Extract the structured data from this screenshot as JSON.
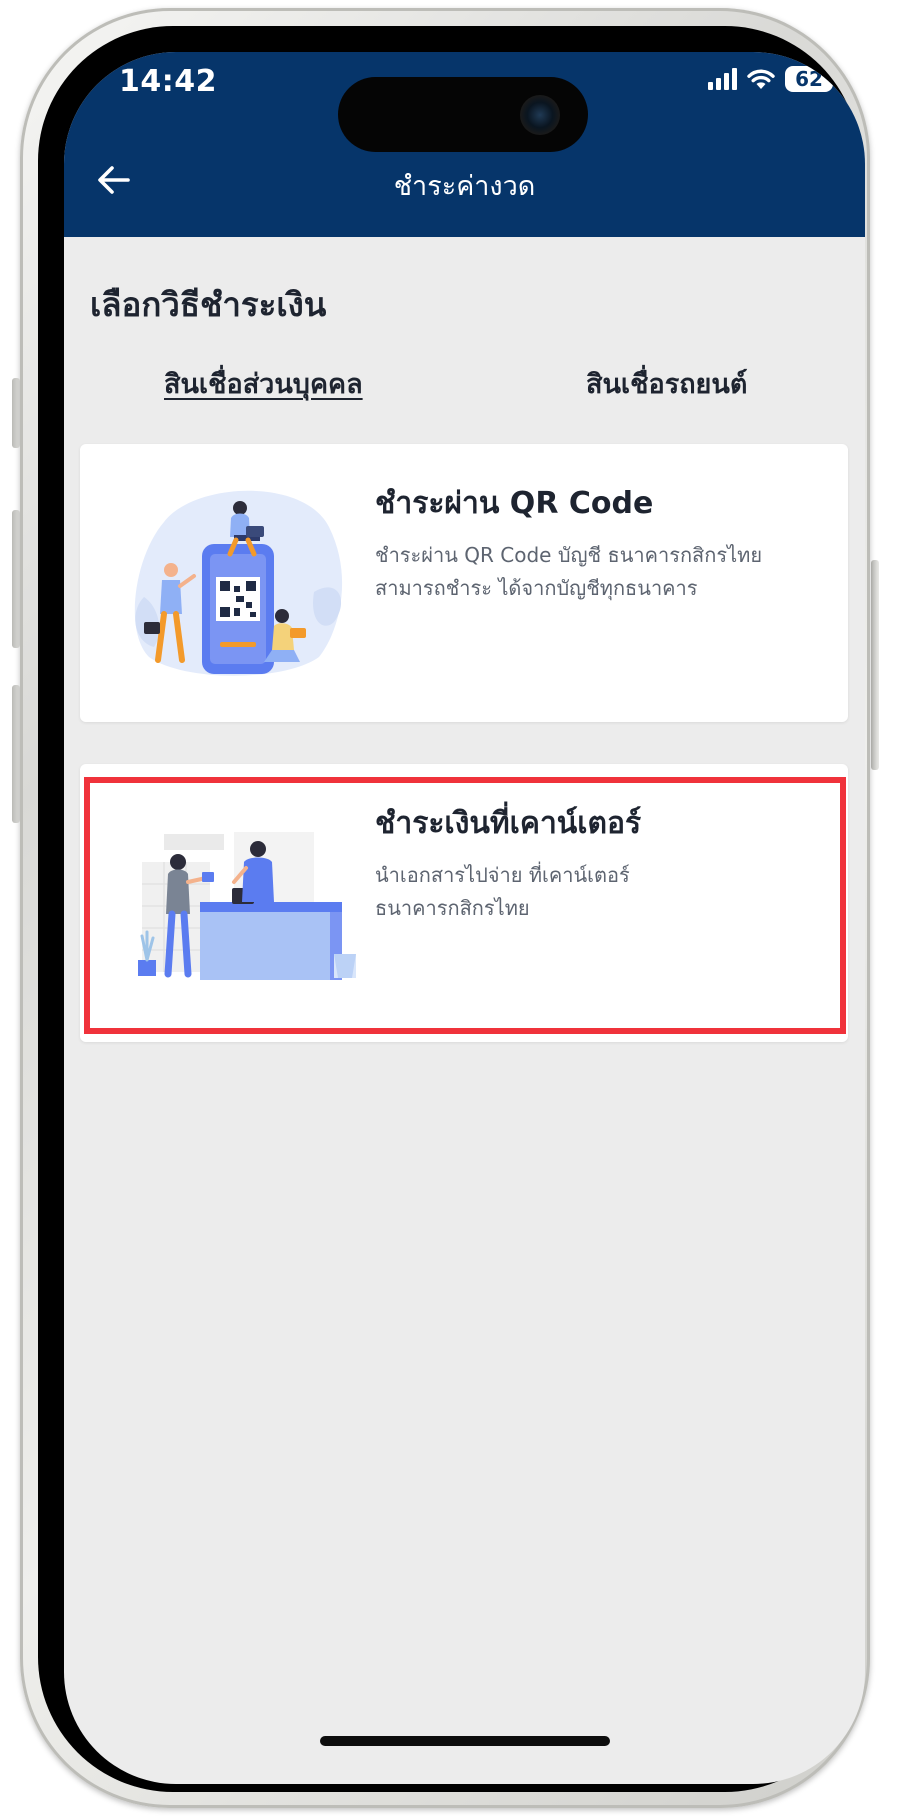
{
  "status_bar": {
    "time": "14:42",
    "battery": "62"
  },
  "header": {
    "title": "ชำระค่างวด"
  },
  "page": {
    "section_title": "เลือกวิธีชำระเงิน"
  },
  "tabs": [
    {
      "label": "สินเชื่อส่วนบุคคล",
      "active": true
    },
    {
      "label": "สินเชื่อรถยนต์",
      "active": false
    }
  ],
  "payment_options": [
    {
      "title": "ชำระผ่าน QR Code",
      "description": "ชำระผ่าน QR Code บัญชี ธนาคารกสิกรไทย สามารถชำระ ได้จากบัญชีทุกธนาคาร",
      "illustration": "qr-payment-illustration"
    },
    {
      "title": "ชำระเงินที่เคาน์เตอร์",
      "description": "นำเอกสารไปจ่าย ที่เคาน์เตอร์ ธนาคารกสิกรไทย",
      "illustration": "bank-counter-illustration"
    }
  ],
  "colors": {
    "header_bg": "#06356a",
    "page_bg": "#ececec",
    "highlight": "#f0323b",
    "illustration_blue": "#5b7cf0"
  }
}
